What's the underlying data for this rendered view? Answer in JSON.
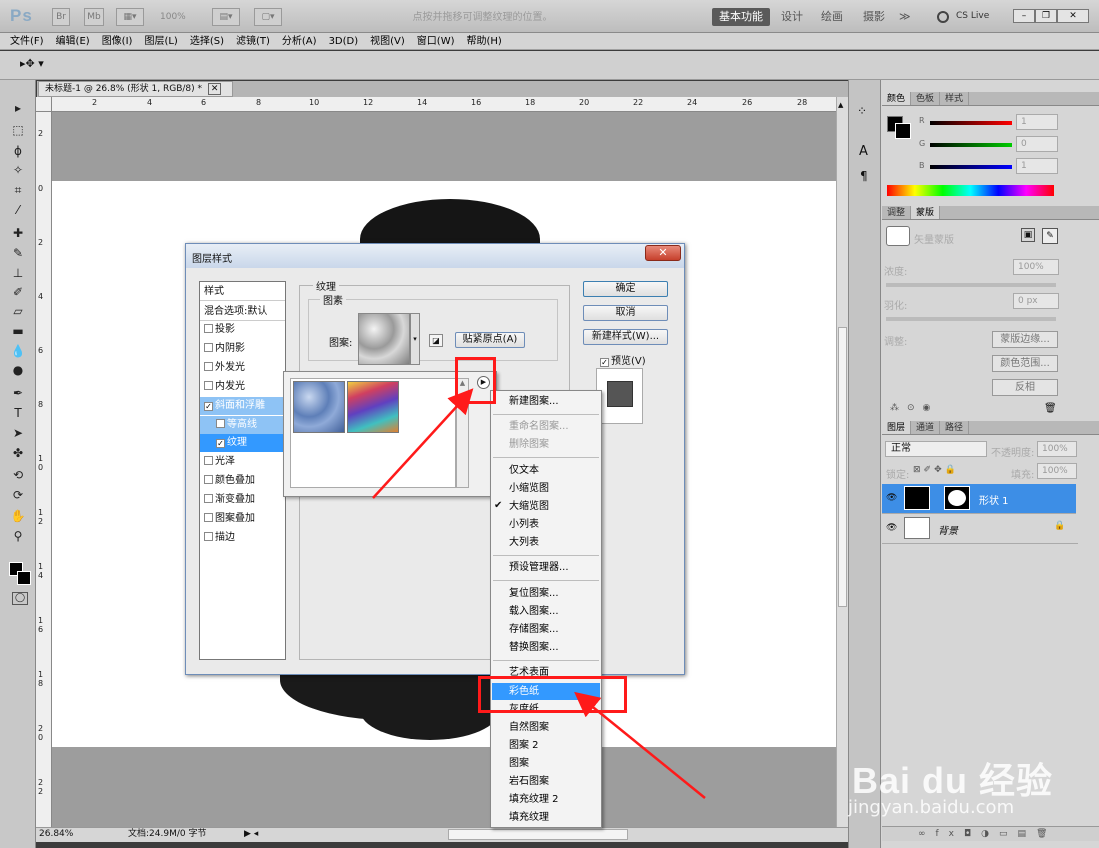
{
  "app": {
    "logo": "Ps",
    "zoom_control": "100%",
    "workspaces": [
      "基本功能",
      "设计",
      "绘画",
      "摄影",
      "≫"
    ],
    "cs_live": "CS Live"
  },
  "menubar": [
    "文件(F)",
    "编辑(E)",
    "图像(I)",
    "图层(L)",
    "选择(S)",
    "滤镜(T)",
    "分析(A)",
    "3D(D)",
    "视图(V)",
    "窗口(W)",
    "帮助(H)"
  ],
  "options_bar": {
    "hint": "点按并拖移可调整纹理的位置。"
  },
  "document": {
    "tab_title": "未标题-1 @ 26.8% (形状 1, RGB/8) *",
    "ruler_h": [
      "2",
      "4",
      "6",
      "8",
      "10",
      "12",
      "14",
      "16",
      "18",
      "20",
      "22",
      "24",
      "26",
      "28"
    ],
    "ruler_v": [
      "2",
      "0",
      "2",
      "4",
      "6",
      "8",
      "1 0",
      "1 2",
      "1 4",
      "1 6",
      "1 8",
      "2 0",
      "2 2"
    ],
    "zoom_status": "26.84%",
    "doc_info": "文档:24.9M/0 字节"
  },
  "color_panel": {
    "tabs": [
      "颜色",
      "色板",
      "样式"
    ],
    "channels": [
      {
        "label": "R",
        "value": "1"
      },
      {
        "label": "G",
        "value": "0"
      },
      {
        "label": "B",
        "value": "1"
      }
    ]
  },
  "masks_panel": {
    "tabs": [
      "调整",
      "蒙版"
    ],
    "title": "矢量蒙版",
    "density_label": "浓度:",
    "density_value": "100%",
    "feather_label": "羽化:",
    "feather_value": "0 px",
    "refine_label": "调整:",
    "buttons": [
      "蒙版边缘...",
      "颜色范围...",
      "反相"
    ]
  },
  "layers_panel": {
    "tabs": [
      "图层",
      "通道",
      "路径"
    ],
    "blend_mode": "正常",
    "opacity_label": "不透明度:",
    "opacity_value": "100%",
    "lock_label": "锁定:",
    "fill_label": "填充:",
    "fill_value": "100%",
    "layers": [
      {
        "name": "形状 1",
        "selected": true
      },
      {
        "name": "背景",
        "selected": false
      }
    ]
  },
  "dialog": {
    "title": "图层样式",
    "styles_header": "样式",
    "blend_options": "混合选项:默认",
    "styles": [
      {
        "label": "投影",
        "checked": false
      },
      {
        "label": "内阴影",
        "checked": false
      },
      {
        "label": "外发光",
        "checked": false
      },
      {
        "label": "内发光",
        "checked": false
      },
      {
        "label": "斜面和浮雕",
        "checked": true
      },
      {
        "label": "等高线",
        "checked": false
      },
      {
        "label": "纹理",
        "checked": true
      },
      {
        "label": "光泽",
        "checked": false
      },
      {
        "label": "颜色叠加",
        "checked": false
      },
      {
        "label": "渐变叠加",
        "checked": false
      },
      {
        "label": "图案叠加",
        "checked": false
      },
      {
        "label": "描边",
        "checked": false
      }
    ],
    "section_title": "纹理",
    "group_title": "图素",
    "pattern_label": "图案:",
    "snap_button": "贴紧原点(A)",
    "ok": "确定",
    "cancel": "取消",
    "new_style": "新建样式(W)...",
    "preview": "预览(V)"
  },
  "context_menu": {
    "group1": [
      {
        "label": "新建图案...",
        "disabled": false
      }
    ],
    "group2": [
      {
        "label": "重命名图案...",
        "disabled": true
      },
      {
        "label": "删除图案",
        "disabled": true
      }
    ],
    "group3": [
      {
        "label": "仅文本",
        "checked": false
      },
      {
        "label": "小缩览图",
        "checked": false
      },
      {
        "label": "大缩览图",
        "checked": true
      },
      {
        "label": "小列表",
        "checked": false
      },
      {
        "label": "大列表",
        "checked": false
      }
    ],
    "group4": [
      "预设管理器..."
    ],
    "group5": [
      "复位图案...",
      "载入图案...",
      "存储图案...",
      "替换图案..."
    ],
    "group6": [
      "艺术表面",
      "彩色纸",
      "灰度纸",
      "自然图案",
      "图案 2",
      "图案",
      "岩石图案",
      "填充纹理 2",
      "填充纹理"
    ],
    "highlighted": "彩色纸"
  },
  "watermark": {
    "brand": "Bai  du 经验",
    "url": "jingyan.baidu.com"
  },
  "colors": {
    "accent": "#3399ff",
    "annotation": "#ff1a1a",
    "canvas_bg": "#9d9d9d"
  }
}
